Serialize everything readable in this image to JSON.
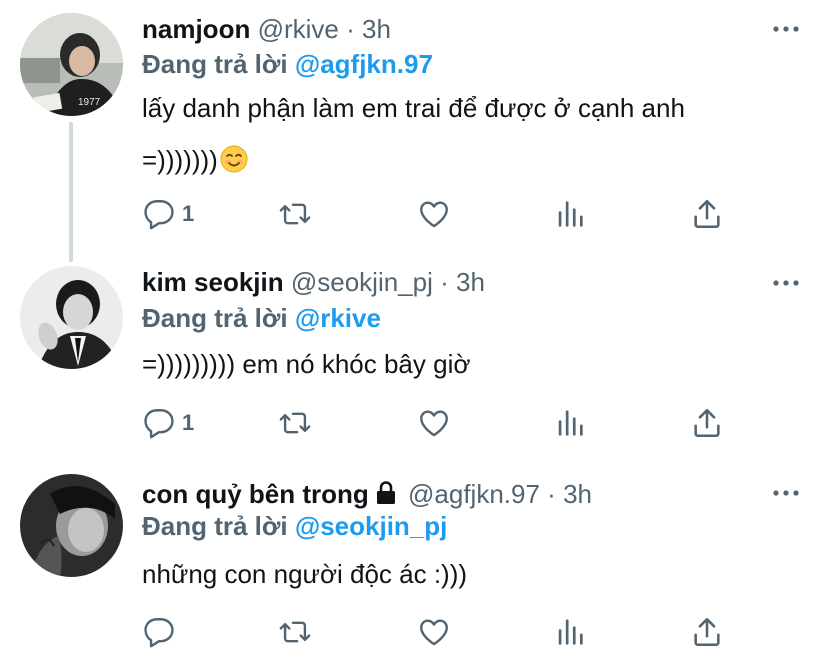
{
  "tweets": [
    {
      "name": "namjoon",
      "handle": "@rkive",
      "separator": "·",
      "time": "3h",
      "reply_label": "Đang trả lời",
      "reply_to": "@agfjkn.97",
      "text_line1": "lấy danh phận làm em trai để được ở cạnh anh",
      "text_line2": "=)))))))",
      "emoji_icon": "smiling-face-icon",
      "reply_count": "1",
      "locked": false
    },
    {
      "name": "kim seokjin",
      "handle": "@seokjin_pj",
      "separator": "·",
      "time": "3h",
      "reply_label": "Đang trả lời",
      "reply_to": "@rkive",
      "text_line1": "=))))))))) em nó khóc bây giờ",
      "reply_count": "1",
      "locked": false
    },
    {
      "name": "con quỷ bên trong",
      "handle": "@agfjkn.97",
      "separator": "·",
      "time": "3h",
      "reply_label": "Đang trả lời",
      "reply_to": "@seokjin_pj",
      "text_line1": "những con người độc ác :)))",
      "reply_count": "",
      "locked": true
    }
  ],
  "icons": {
    "more": "more-horizontal-icon",
    "reply": "comment-icon",
    "retweet": "retweet-icon",
    "like": "heart-icon",
    "views": "analytics-icon",
    "share": "share-icon",
    "lock": "lock-icon"
  },
  "colors": {
    "link": "#1d9bf0",
    "secondary_text": "#536471",
    "primary_text": "#0f1419",
    "thread_line": "#cfd9de"
  }
}
